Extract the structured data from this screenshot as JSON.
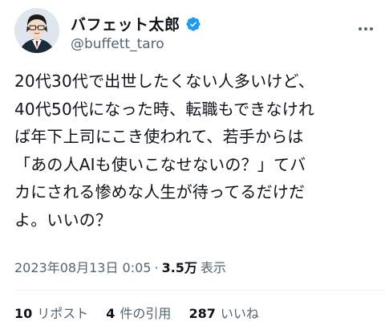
{
  "author": {
    "display_name": "バフェット太郎",
    "handle": "@buffett_taro",
    "verified": true
  },
  "tweet": {
    "lines": [
      "20代30代で出世したくない人多いけど、",
      "40代50代になった時、転職もできなけれ",
      "ば年下上司にこき使われて、若手からは",
      "「あの人AIも使いこなせないの？」てバ",
      "カにされる惨めな人生が待ってるだけだ",
      "よ。いいの？"
    ]
  },
  "meta": {
    "datetime": "2023年08月13日 0:05",
    "separator": "·",
    "views_count": "3.5万",
    "views_label": "表示"
  },
  "stats": {
    "reposts_count": "10",
    "reposts_label": "リポスト",
    "quotes_count": "4",
    "quotes_label": "件の引用",
    "likes_count": "287",
    "likes_label": "いいね"
  },
  "colors": {
    "verified_blue": "#1d9bf0",
    "secondary_text": "#536471",
    "primary_text": "#0f1419"
  },
  "icons": {
    "verified": "verified-badge-icon",
    "more": "more-options-icon"
  }
}
